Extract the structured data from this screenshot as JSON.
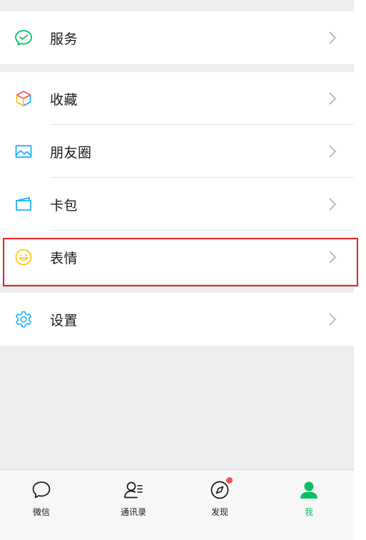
{
  "menu": {
    "group1": [
      {
        "label": "服务",
        "icon": "wechat-pay-icon"
      }
    ],
    "group2": [
      {
        "label": "收藏",
        "icon": "favorites-cube-icon"
      },
      {
        "label": "朋友圈",
        "icon": "moments-photo-icon"
      },
      {
        "label": "卡包",
        "icon": "card-wallet-icon"
      },
      {
        "label": "表情",
        "icon": "sticker-smiley-icon"
      }
    ],
    "group3": [
      {
        "label": "设置",
        "icon": "settings-gear-icon"
      }
    ]
  },
  "tabbar": {
    "tabs": [
      {
        "label": "微信",
        "icon": "chat-bubble-icon",
        "active": false
      },
      {
        "label": "通讯录",
        "icon": "contacts-icon",
        "active": false
      },
      {
        "label": "发现",
        "icon": "discover-compass-icon",
        "active": false,
        "badge": "dot"
      },
      {
        "label": "我",
        "icon": "me-person-icon",
        "active": true
      }
    ]
  },
  "colors": {
    "accent": "#07c160",
    "highlight_border": "#e02424",
    "badge": "#fa5151",
    "background": "#ededed"
  }
}
